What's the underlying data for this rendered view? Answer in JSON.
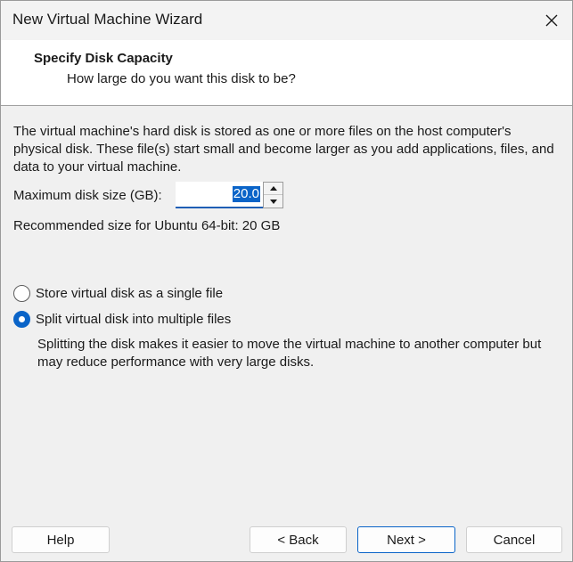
{
  "window": {
    "title": "New Virtual Machine Wizard"
  },
  "header": {
    "title": "Specify Disk Capacity",
    "subtitle": "How large do you want this disk to be?"
  },
  "body": {
    "description": "The virtual machine's hard disk is stored as one or more files on the host computer's physical disk. These file(s) start small and become larger as you add applications, files, and data to your virtual machine.",
    "disk_size_label": "Maximum disk size (GB):",
    "disk_size_value": "20.0",
    "recommended_text": "Recommended size for Ubuntu 64-bit: 20 GB"
  },
  "options": {
    "single_label": "Store virtual disk as a single file",
    "single_checked": false,
    "split_label": "Split virtual disk into multiple files",
    "split_checked": true,
    "split_note": "Splitting the disk makes it easier to move the virtual machine to another computer but may reduce performance with very large disks."
  },
  "buttons": {
    "help": "Help",
    "back": "< Back",
    "next": "Next >",
    "cancel": "Cancel"
  },
  "icons": {
    "close": "close-icon",
    "spin_up": "spin-up-icon",
    "spin_down": "spin-down-icon"
  },
  "colors": {
    "accent": "#0a64c8",
    "background": "#f0f0f0",
    "header_bg": "#ffffff"
  }
}
